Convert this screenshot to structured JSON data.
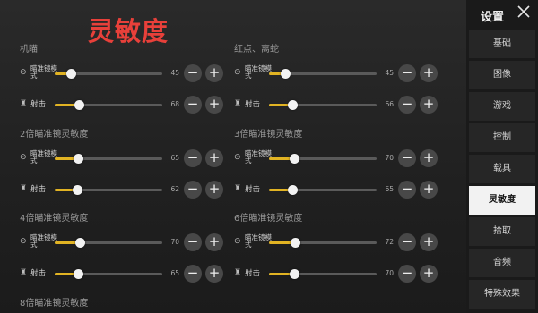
{
  "overlay_title": "灵敏度",
  "header": {
    "title": "设置"
  },
  "sidebar": {
    "items": [
      {
        "label": "基础",
        "active": false
      },
      {
        "label": "图像",
        "active": false
      },
      {
        "label": "游戏",
        "active": false
      },
      {
        "label": "控制",
        "active": false
      },
      {
        "label": "载具",
        "active": false
      },
      {
        "label": "灵敏度",
        "active": true
      },
      {
        "label": "拾取",
        "active": false
      },
      {
        "label": "音频",
        "active": false
      },
      {
        "label": "特殊效果",
        "active": false
      }
    ]
  },
  "sections": [
    {
      "title": "机瞄",
      "rows": [
        {
          "label": "瞄准镜模式",
          "value": "45"
        },
        {
          "label": "射击",
          "value": "68"
        }
      ]
    },
    {
      "title": "红点、离蛇",
      "rows": [
        {
          "label": "瞄准镜模式",
          "value": "45"
        },
        {
          "label": "射击",
          "value": "66"
        }
      ]
    },
    {
      "title": "2倍瞄准镜灵敏度",
      "rows": [
        {
          "label": "瞄准镜模式",
          "value": "65"
        },
        {
          "label": "射击",
          "value": "62"
        }
      ]
    },
    {
      "title": "3倍瞄准镜灵敏度",
      "rows": [
        {
          "label": "瞄准镜模式",
          "value": "70"
        },
        {
          "label": "射击",
          "value": "65"
        }
      ]
    },
    {
      "title": "4倍瞄准镜灵敏度",
      "rows": [
        {
          "label": "瞄准镜模式",
          "value": "70"
        },
        {
          "label": "射击",
          "value": "65"
        }
      ]
    },
    {
      "title": "6倍瞄准镜灵敏度",
      "rows": [
        {
          "label": "瞄准镜模式",
          "value": "72"
        },
        {
          "label": "射击",
          "value": "70"
        }
      ]
    },
    {
      "title": "8倍瞄准镜灵敏度",
      "rows": []
    }
  ],
  "buttons": {
    "minus": "−",
    "plus": "+"
  },
  "slider_max": 300,
  "colors": {
    "accent": "#e1b323",
    "overlay_text": "#e8403a",
    "active_tab_bg": "#f2f2f2"
  }
}
